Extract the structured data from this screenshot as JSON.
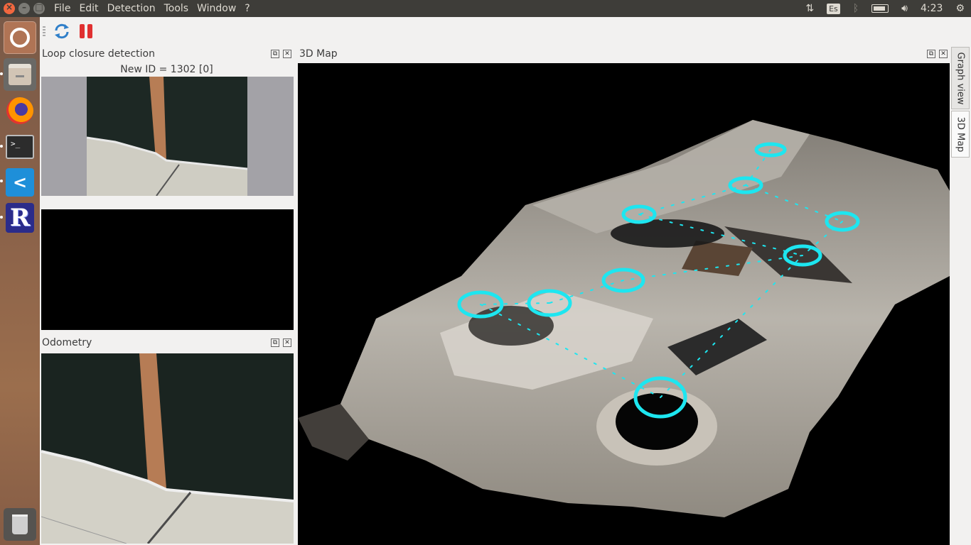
{
  "menubar": {
    "items": [
      "File",
      "Edit",
      "Detection",
      "Tools",
      "Window",
      "?"
    ]
  },
  "indicators": {
    "keyboard": "Es",
    "time": "4:23"
  },
  "launcher": {
    "terminal_text": ">_",
    "vscode_text": "<",
    "rtab_text": "R"
  },
  "panels": {
    "loop_closure": {
      "title": "Loop closure detection",
      "new_id": "New ID = 1302 [0]"
    },
    "odometry": {
      "title": "Odometry"
    },
    "map3d": {
      "title": "3D Map"
    }
  },
  "side_tabs": [
    "Graph view",
    "3D Map"
  ],
  "colors": {
    "graph": "#1de6f0",
    "close_button": "#f1673f"
  }
}
